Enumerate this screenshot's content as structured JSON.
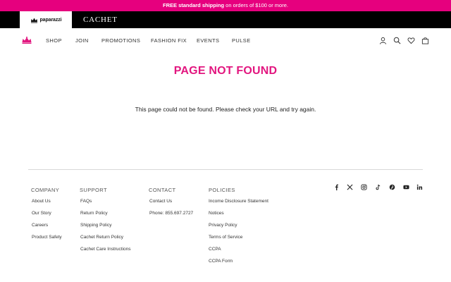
{
  "promo": {
    "bold": "FREE standard shipping",
    "rest": " on orders of $100 or more."
  },
  "brands": {
    "paparazzi": "paparazzi",
    "cachet": "CACHET"
  },
  "nav": {
    "items": [
      "SHOP",
      "JOIN",
      "PROMOTIONS",
      "FASHION FIX",
      "EVENTS",
      "PULSE"
    ]
  },
  "main": {
    "title": "PAGE NOT FOUND",
    "message": "This page could not be found. Please check your URL and try again."
  },
  "footer": {
    "company": {
      "heading": "COMPANY",
      "links": [
        "About Us",
        "Our Story",
        "Careers",
        "Product Safety"
      ]
    },
    "support": {
      "heading": "SUPPORT",
      "links": [
        "FAQs",
        "Return Policy",
        "Shipping Policy",
        "Cachet Return Policy",
        "Cachet Care Instructions"
      ]
    },
    "contact": {
      "heading": "CONTACT",
      "links": [
        "Contact Us",
        "Phone: 855.697.2727"
      ]
    },
    "policies": {
      "heading": "POLICIES",
      "links": [
        "Income Disclosure Statement",
        "Notices",
        "Privacy Policy",
        "Terms of Service",
        "CCPA",
        "CCPA Form"
      ]
    },
    "social": [
      "facebook-icon",
      "x-icon",
      "instagram-icon",
      "tiktok-icon",
      "pinterest-icon",
      "youtube-icon",
      "linkedin-icon"
    ]
  },
  "colors": {
    "accent": "#e2167f",
    "promo_bg": "#e6007e",
    "brandbar_bg": "#000000"
  }
}
